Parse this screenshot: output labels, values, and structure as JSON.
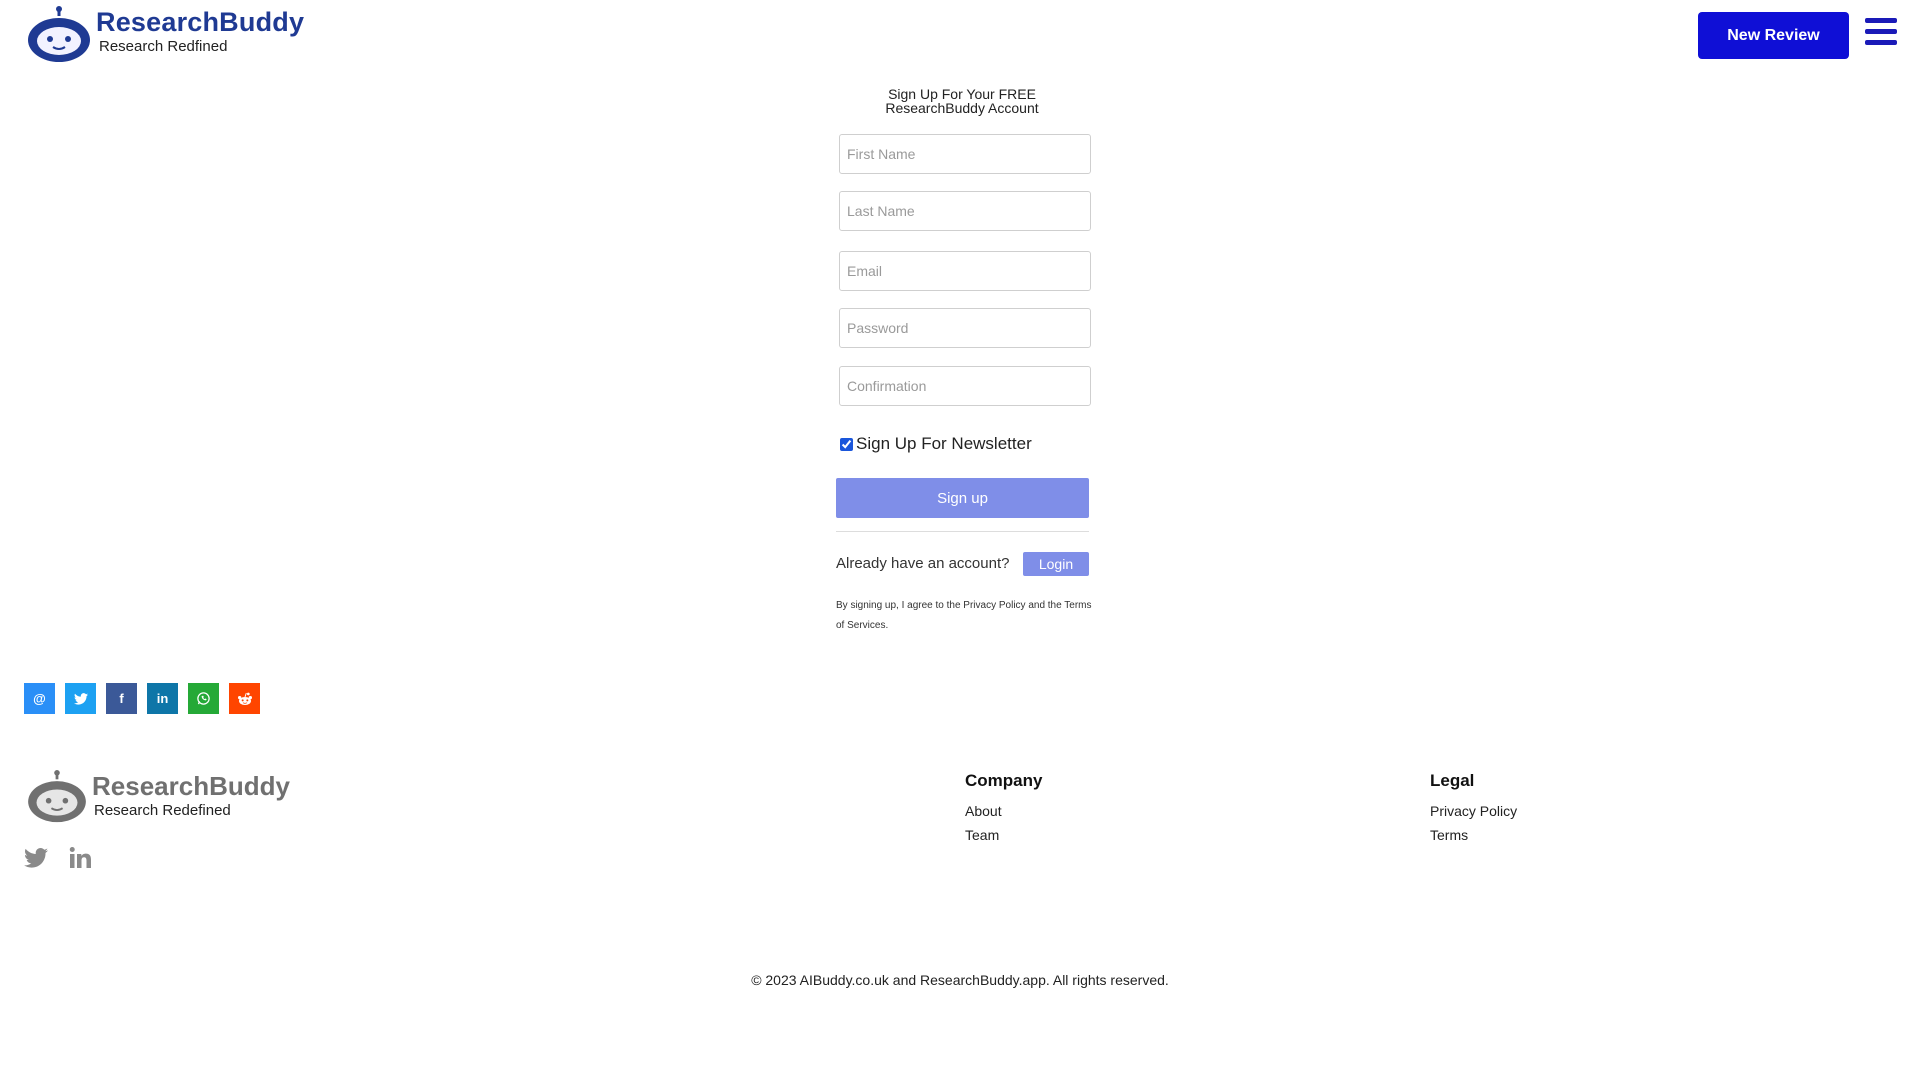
{
  "header": {
    "brand_name": "ResearchBuddy",
    "brand_tagline": "Research Redfined",
    "new_review_label": "New Review",
    "menu_icon": "hamburger-menu-icon"
  },
  "signup_form": {
    "heading_line1": "Sign Up For Your FREE",
    "heading_line2": "ResearchBuddy Account",
    "first_name_placeholder": "First Name",
    "last_name_placeholder": "Last Name",
    "email_placeholder": "Email",
    "password_placeholder": "Password",
    "confirmation_placeholder": "Confirmation",
    "newsletter_label": "Sign Up For Newsletter",
    "newsletter_checked": true,
    "signup_label": "Sign up",
    "already_text": "Already have an account?",
    "login_label": "Login",
    "terms_text": "By signing up, I agree to the Privacy Policy and the Terms of Services."
  },
  "share_bar": {
    "buttons": [
      {
        "name": "email",
        "glyph": "@",
        "color": "#2a8ff7"
      },
      {
        "name": "twitter",
        "glyph": "",
        "color": "#1da1f2"
      },
      {
        "name": "facebook",
        "glyph": "f",
        "color": "#3b5998"
      },
      {
        "name": "linkedin",
        "glyph": "in",
        "color": "#0e76a8"
      },
      {
        "name": "whatsapp",
        "glyph": "",
        "color": "#25a937"
      },
      {
        "name": "reddit",
        "glyph": "",
        "color": "#ff4500"
      }
    ]
  },
  "footer": {
    "brand_name": "ResearchBuddy",
    "brand_tagline": "Research Redefined",
    "social_icons": [
      "twitter-icon",
      "linkedin-icon"
    ],
    "company": {
      "heading": "Company",
      "links": [
        "About",
        "Team"
      ]
    },
    "legal": {
      "heading": "Legal",
      "links": [
        "Privacy Policy",
        "Terms"
      ]
    },
    "copyright": "© 2023 AIBuddy.co.uk and ResearchBuddy.app. All rights reserved."
  }
}
